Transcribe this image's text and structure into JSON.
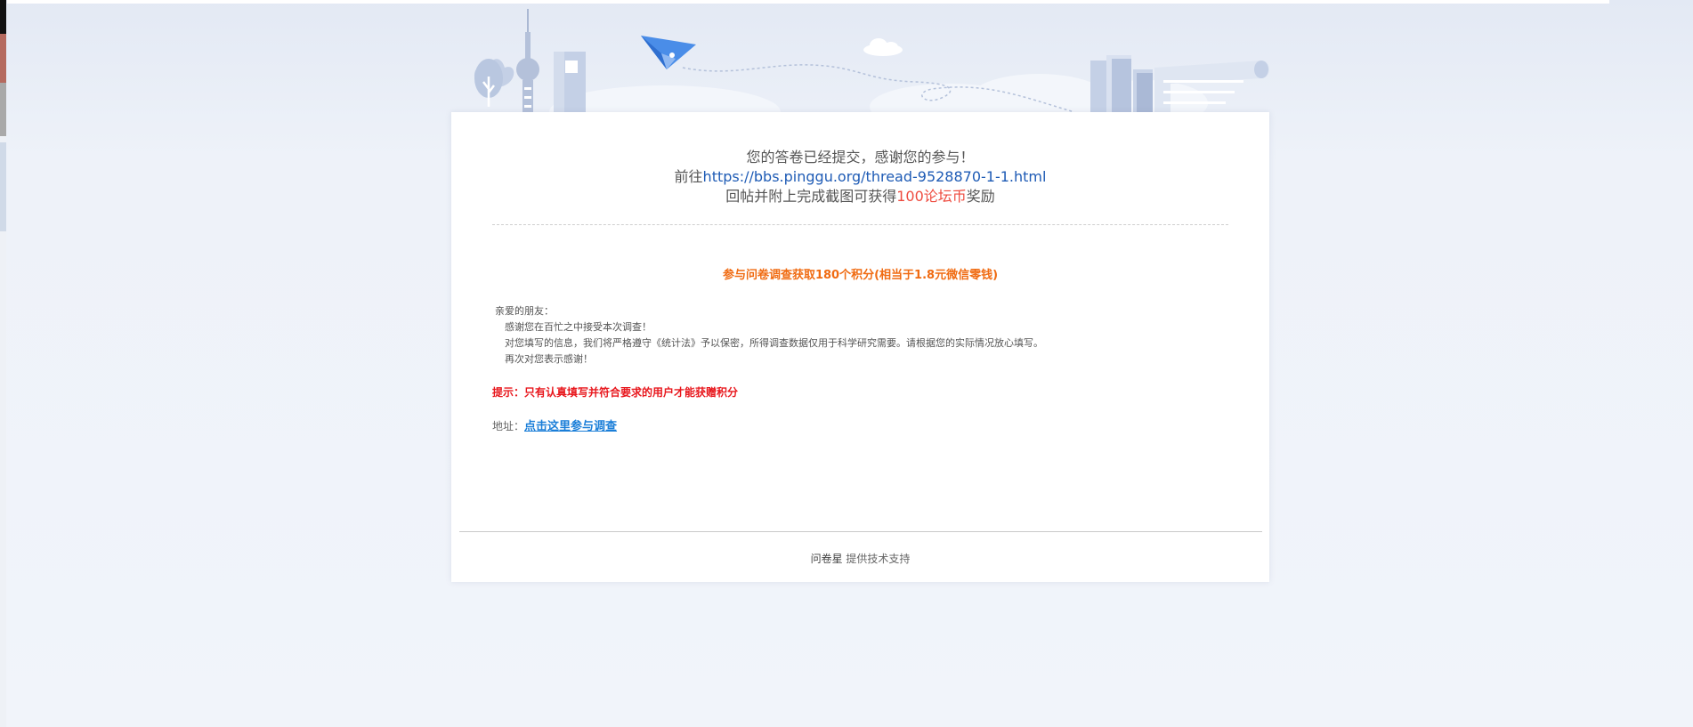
{
  "message": {
    "line1": "您的答卷已经提交，感谢您的参与！",
    "line2_prefix": "前往",
    "line2_link": "https://bbs.pinggu.org/thread-9528870-1-1.html",
    "line3_prefix": "回帖并附上完成截图可获得",
    "line3_highlight": "100论坛币",
    "line3_suffix": "奖励"
  },
  "survey": {
    "title": "参与问卷调查获取180个积分(相当于1.8元微信零钱)",
    "intro": [
      "亲爱的朋友：",
      "感谢您在百忙之中接受本次调查！",
      "对您填写的信息，我们将严格遵守《统计法》予以保密，所得调查数据仅用于科学研究需要。请根据您的实际情况放心填写。",
      "再次对您表示感谢！"
    ],
    "tip": "提示：只有认真填写并符合要求的用户才能获赠积分",
    "address_label": "地址：",
    "address_link": "点击这里参与调查"
  },
  "footer": {
    "brand": "问卷星",
    "text": " 提供技术支持"
  },
  "colors": {
    "accent_link": "#1e5bb5",
    "highlight_red": "#ee4b3f",
    "title_orange": "#f06b12",
    "tip_red": "#e8171d"
  },
  "icons": [
    "tree-icon",
    "tv-tower-icon",
    "building-icon",
    "paper-plane-icon",
    "cloud-icon",
    "books-icon",
    "scroll-icon"
  ]
}
